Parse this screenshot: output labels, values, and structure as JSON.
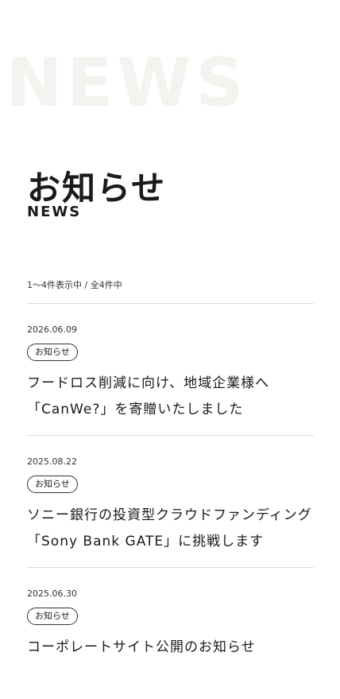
{
  "hero": {
    "background_word": "NEWS",
    "title": "お知らせ",
    "subtitle": "NEWS"
  },
  "count_text": "1〜4件表示中 / 全4件中",
  "items": [
    {
      "date": "2026.06.09",
      "category": "お知らせ",
      "title_line1": "フードロス削減に向け、地域企業様へ",
      "title_line2": "「CanWe?」を寄贈いたしました"
    },
    {
      "date": "2025.08.22",
      "category": "お知らせ",
      "title_line1": "ソニー銀行の投資型クラウドファンディング",
      "title_line2": "「Sony Bank GATE」に挑戦します"
    },
    {
      "date": "2025.06.30",
      "category": "お知らせ",
      "title_line1": "コーポレートサイト公開のお知らせ",
      "title_line2": ""
    }
  ]
}
